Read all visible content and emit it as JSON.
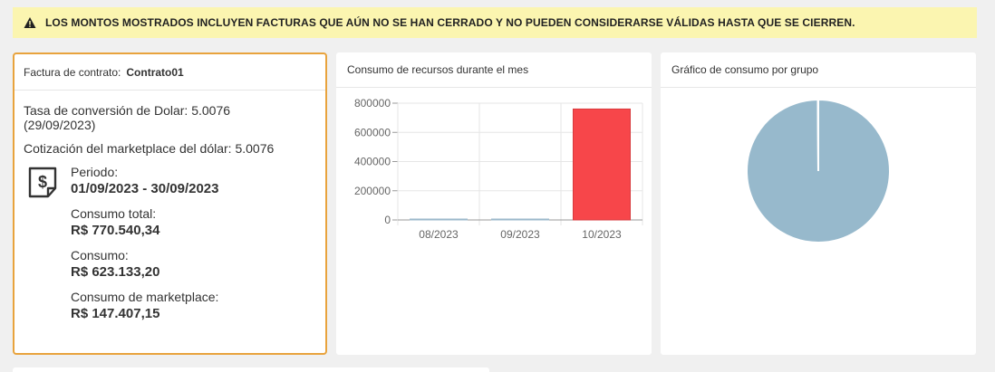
{
  "alert": {
    "icon": "warning-icon",
    "text": "LOS MONTOS MOSTRADOS INCLUYEN FACTURAS QUE AÚN NO SE HAN CERRADO Y NO PUEDEN CONSIDERARSE VÁLIDAS HASTA QUE SE CIERREN."
  },
  "contract": {
    "header_label": "Factura de contrato:",
    "header_value": "Contrato01",
    "rate_label": "Tasa de conversión de Dolar: 5.0076",
    "rate_date": "(29/09/2023)",
    "marketplace_rate": "Cotización del marketplace del dólar: 5.0076",
    "icon": "dollar-invoice-icon",
    "period_label": "Periodo:",
    "period_value": "01/09/2023 - 30/09/2023",
    "total_label": "Consumo total:",
    "total_value": "R$ 770.540,34",
    "consumption_label": "Consumo:",
    "consumption_value": "R$ 623.133,20",
    "marketplace_label": "Consumo de marketplace:",
    "marketplace_value": "R$ 147.407,15",
    "accent_color": "#e8a33d"
  },
  "resource_chart": {
    "title": "Consumo de recursos durante el mes",
    "chart_data": {
      "type": "bar",
      "categories": [
        "08/2023",
        "09/2023",
        "10/2023"
      ],
      "values": [
        0,
        0,
        760000
      ],
      "ylim": [
        0,
        800000
      ],
      "yticks": [
        0,
        200000,
        400000,
        600000,
        800000
      ],
      "ytick_labels": [
        "0",
        "200000",
        "400000",
        "600000",
        "800000"
      ],
      "grid": true,
      "colors": [
        "#9bb8cb",
        "#9bb8cb",
        "#f7464a"
      ]
    }
  },
  "group_chart": {
    "title": "Gráfico de consumo por grupo",
    "chart_data": {
      "type": "pie",
      "slices": [
        {
          "value": 100,
          "color": "#97b9cc"
        },
        {
          "value": 0.1,
          "color": "#97b9cc"
        }
      ]
    }
  }
}
